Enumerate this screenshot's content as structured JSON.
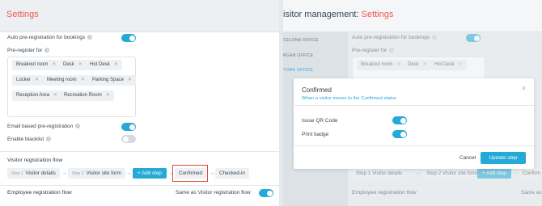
{
  "left": {
    "title": "Settings",
    "auto_prereg_label": "Auto pre-registration for bookings",
    "auto_prereg_on": true,
    "preregister_for_label": "Pre-register for",
    "chips": [
      "Breakout room",
      "Desk",
      "Hot Desk",
      "Locker",
      "Meeting room",
      "Parking Space",
      "Reception Area",
      "Recreation Room"
    ],
    "email_prereg_label": "Email based pre-registration",
    "email_prereg_on": true,
    "enable_blacklist_label": "Enable blacklist",
    "enable_blacklist_on": false,
    "visitor_flow_title": "Visitor registration flow",
    "steps": [
      {
        "num": "Step 1",
        "label": "Visitor details"
      },
      {
        "num": "Step 2",
        "label": "Visitor site form"
      }
    ],
    "add_step_label": "+ Add step",
    "confirmed_label": "Confirmed",
    "checked_in_label": "Checked-in",
    "employee_flow_title": "Employee registration flow",
    "employee_flow_value": "Same as Visitor registration flow",
    "employee_flow_on": true
  },
  "right": {
    "title_prefix": "isitor management: ",
    "title": "Settings",
    "nav": [
      "CELONA OFFICE",
      "RGAN OFFICE",
      "YORK OFFICE"
    ],
    "auto_prereg_label": "Auto pre-registration for bookings",
    "preregister_for_label": "Pre-register for",
    "chips": [
      "Breakout room",
      "Desk",
      "Hot Desk"
    ],
    "step1": "Step 1  Visitor details",
    "step2": "Step 2  Visitor site form",
    "add_step_label": "+ Add step",
    "confirmed_partial": "Confirm",
    "employee_flow_title": "Employee registration flow",
    "employee_flow_partial": "Same as"
  },
  "modal": {
    "title": "Confirmed",
    "subtitle": "When a visitor moves to the Confirmed status",
    "close_icon": "close-icon",
    "issue_qr_label": "Issue QR Code",
    "issue_qr_on": true,
    "print_badge_label": "Print badge",
    "print_badge_on": true,
    "cancel_label": "Cancel",
    "update_label": "Update step"
  },
  "colors": {
    "accent": "#25a9d6",
    "title_red": "#f0584e",
    "highlight_red": "#e0473c"
  }
}
